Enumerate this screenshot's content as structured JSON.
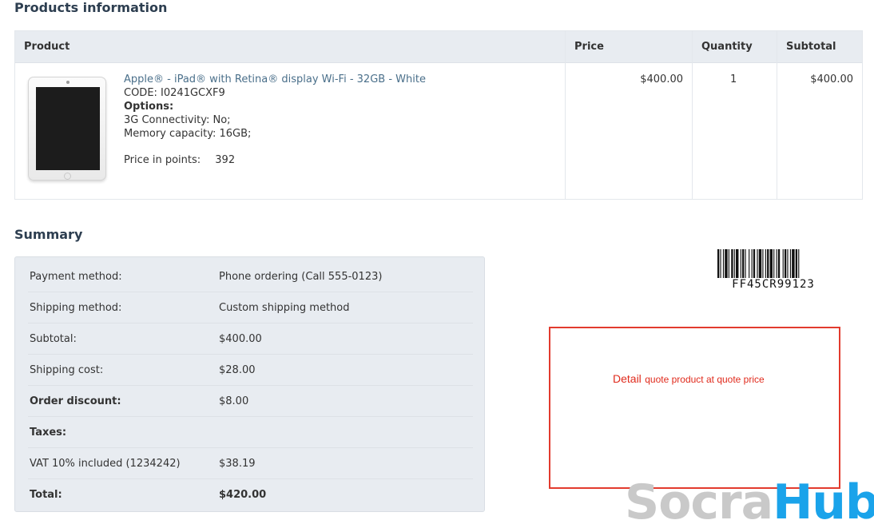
{
  "products": {
    "title": "Products information",
    "columns": [
      "Product",
      "Price",
      "Quantity",
      "Subtotal"
    ],
    "item": {
      "name": "Apple® - iPad® with Retina® display Wi-Fi - 32GB - White",
      "code": "CODE: I0241GCXF9",
      "options_label": "Options:",
      "options": [
        "3G Connectivity: No;",
        "Memory capacity: 16GB;"
      ],
      "points_label": "Price in points:",
      "points_value": "392",
      "price": "$400.00",
      "quantity": "1",
      "subtotal": "$400.00"
    }
  },
  "summary": {
    "title": "Summary",
    "rows": [
      {
        "label": "Payment method:",
        "value": "Phone ordering (Call 555-0123)"
      },
      {
        "label": "Shipping method:",
        "value": "Custom shipping method"
      },
      {
        "label": "Subtotal:",
        "value": "$400.00"
      },
      {
        "label": "Shipping cost:",
        "value": "$28.00"
      },
      {
        "label": "Order discount:",
        "value": "$8.00"
      },
      {
        "label": "Taxes:",
        "value": ""
      },
      {
        "label": "VAT 10% included (1234242)",
        "value": "$38.19"
      },
      {
        "label": "Total:",
        "value": "$420.00"
      }
    ]
  },
  "barcode": {
    "text": "FF45CR99123"
  },
  "quote": {
    "big": "Detail",
    "small": "quote product at quote price"
  },
  "watermark": {
    "part1": "Socra",
    "part2": "Hub"
  },
  "colors": {
    "accent_red": "#e23b2e",
    "watermark_blue": "#1aa3ea",
    "link": "#4a6f8a"
  }
}
